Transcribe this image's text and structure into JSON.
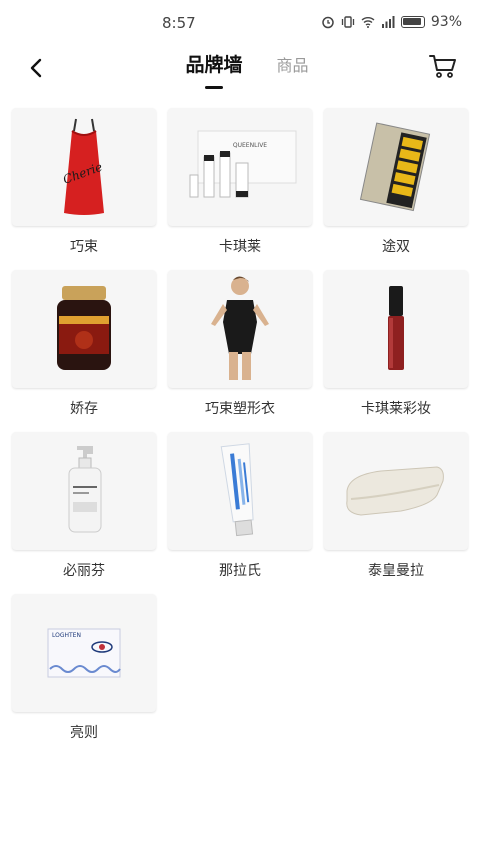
{
  "status": {
    "time": "8:57",
    "battery": "93%"
  },
  "nav": {
    "tab_active": "品牌墙",
    "tab_inactive": "商品"
  },
  "brands": [
    {
      "name": "巧束",
      "product": "red-drawstring-bag"
    },
    {
      "name": "卡琪莱",
      "product": "skincare-set",
      "box_text": "QUEENLIVE"
    },
    {
      "name": "途双",
      "product": "gift-box-set"
    },
    {
      "name": "娇存",
      "product": "supplement-jar"
    },
    {
      "name": "巧束塑形衣",
      "product": "shapewear"
    },
    {
      "name": "卡琪莱彩妆",
      "product": "lip-gloss"
    },
    {
      "name": "必丽芬",
      "product": "lotion-bottle"
    },
    {
      "name": "那拉氏",
      "product": "toothpaste-tube"
    },
    {
      "name": "泰皇曼拉",
      "product": "latex-pillow"
    },
    {
      "name": "亮则",
      "product": "eye-care-box",
      "box_text": "LOGHTEN"
    }
  ],
  "colors": {
    "card_bg": "#f6f6f6",
    "text": "#333333",
    "accent_red": "#d62020"
  }
}
